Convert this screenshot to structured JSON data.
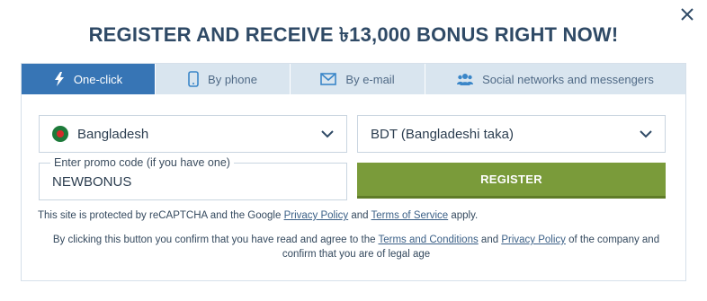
{
  "header": {
    "title": "REGISTER AND RECEIVE ৳13,000 BONUS RIGHT NOW!",
    "close_icon": "close-icon"
  },
  "tabs": [
    {
      "label": "One-click",
      "icon": "lightning-icon",
      "active": true
    },
    {
      "label": "By phone",
      "icon": "phone-icon",
      "active": false
    },
    {
      "label": "By e-mail",
      "icon": "envelope-icon",
      "active": false
    },
    {
      "label": "Social networks and messengers",
      "icon": "people-icon",
      "active": false
    }
  ],
  "form": {
    "country": {
      "value": "Bangladesh",
      "icon": "bangladesh-flag-icon"
    },
    "currency": {
      "value": "BDT (Bangladeshi taka)"
    },
    "promo": {
      "label": "Enter promo code (if you have one)",
      "value": "NEWBONUS"
    },
    "register_label": "REGISTER"
  },
  "notes": {
    "recaptcha_prefix": "This site is protected by reCAPTCHA and the Google ",
    "privacy_policy": "Privacy Policy",
    "and": " and ",
    "terms_of_service": "Terms of Service",
    "apply": " apply.",
    "confirm_prefix": "By clicking this button you confirm that you have read and agree to the ",
    "terms_and_conditions": "Terms and Conditions",
    "and2": " and ",
    "privacy_policy2": "Privacy Policy",
    "confirm_suffix": " of the company and confirm that you are of legal age"
  },
  "colors": {
    "accent": "#3775b5",
    "register": "#7a9b3a",
    "title": "#2f4a66",
    "tab_bg": "#d9e5ef"
  }
}
